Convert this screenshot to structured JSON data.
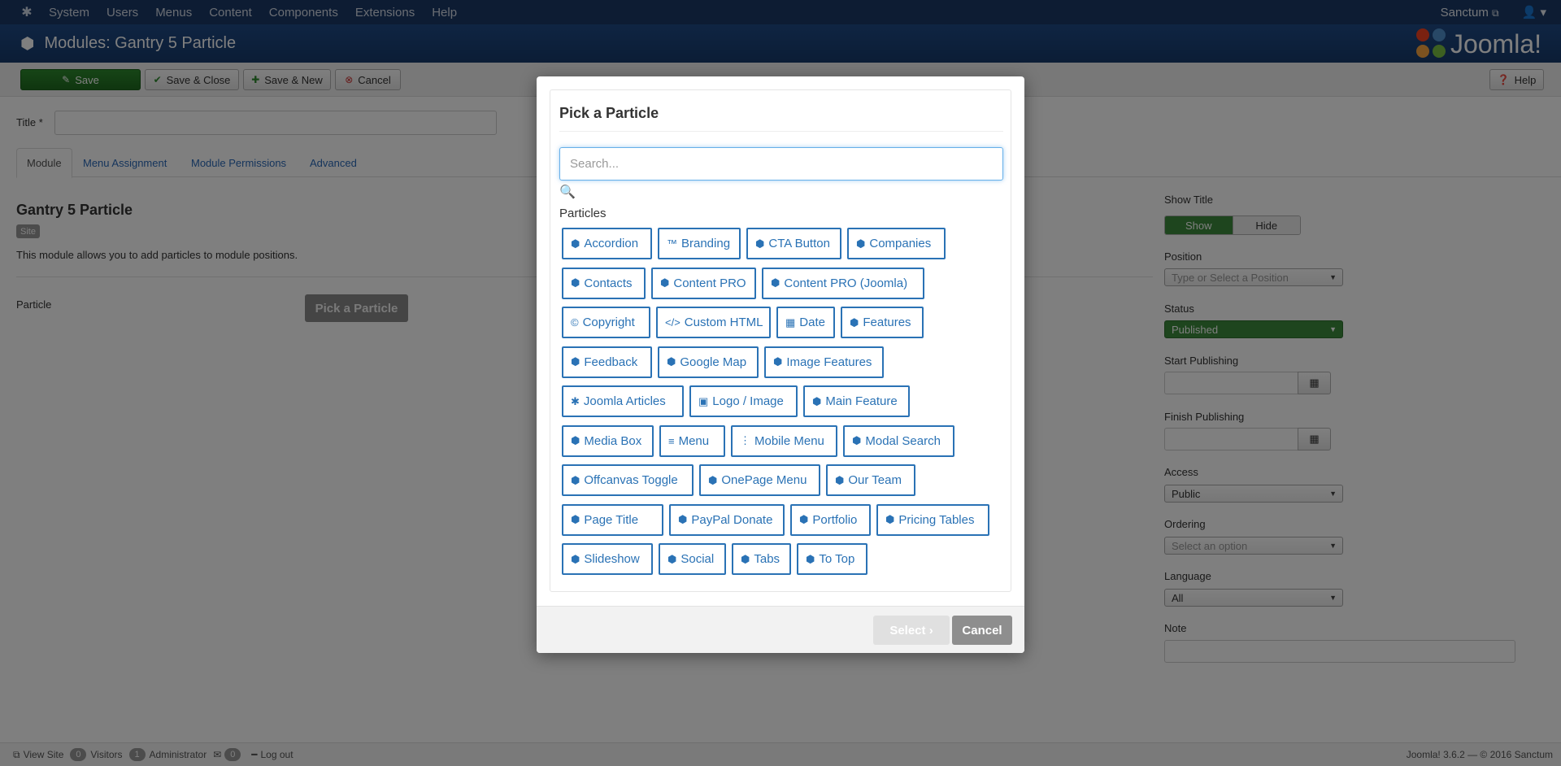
{
  "topnav": {
    "menu": [
      "System",
      "Users",
      "Menus",
      "Content",
      "Components",
      "Extensions",
      "Help"
    ],
    "site_name": "Sanctum"
  },
  "header": {
    "title": "Modules: Gantry 5 Particle",
    "brand": "Joomla!"
  },
  "toolbar": {
    "save": "Save",
    "save_close": "Save & Close",
    "save_new": "Save & New",
    "cancel": "Cancel",
    "help": "Help"
  },
  "form": {
    "title_label": "Title *",
    "tabs": [
      "Module",
      "Menu Assignment",
      "Module Permissions",
      "Advanced"
    ],
    "module_name": "Gantry 5 Particle",
    "site_badge": "Site",
    "description": "This module allows you to add particles to module positions.",
    "particle_label": "Particle",
    "pick_button": "Pick a Particle"
  },
  "sidebar": {
    "show_title_label": "Show Title",
    "show": "Show",
    "hide": "Hide",
    "position_label": "Position",
    "position_placeholder": "Type or Select a Position",
    "status_label": "Status",
    "status_value": "Published",
    "start_label": "Start Publishing",
    "finish_label": "Finish Publishing",
    "access_label": "Access",
    "access_value": "Public",
    "ordering_label": "Ordering",
    "ordering_placeholder": "Select an option",
    "language_label": "Language",
    "language_value": "All",
    "note_label": "Note"
  },
  "statusbar": {
    "view_site": "View Site",
    "visitors_count": "0",
    "visitors": "Visitors",
    "admin_count": "1",
    "administrator": "Administrator",
    "messages_count": "0",
    "logout": "Log out",
    "version": "Joomla! 3.6.2 — © 2016 Sanctum"
  },
  "modal": {
    "title": "Pick a Particle",
    "search_placeholder": "Search...",
    "section": "Particles",
    "select": "Select",
    "cancel": "Cancel",
    "particles": [
      {
        "label": "Accordion",
        "icon": "cube-icon"
      },
      {
        "label": "Branding",
        "icon": "trademark-icon"
      },
      {
        "label": "CTA Button",
        "icon": "cube-icon"
      },
      {
        "label": "Companies",
        "icon": "cube-icon"
      },
      {
        "label": "Contacts",
        "icon": "cube-icon"
      },
      {
        "label": "Content PRO",
        "icon": "cube-icon"
      },
      {
        "label": "Content PRO (Joomla)",
        "icon": "cube-icon"
      },
      {
        "label": "Copyright",
        "icon": "copyright-icon"
      },
      {
        "label": "Custom HTML",
        "icon": "code-icon"
      },
      {
        "label": "Date",
        "icon": "calendar-icon"
      },
      {
        "label": "Features",
        "icon": "cube-icon"
      },
      {
        "label": "Feedback",
        "icon": "cube-icon"
      },
      {
        "label": "Google Map",
        "icon": "cube-icon"
      },
      {
        "label": "Image Features",
        "icon": "cube-icon"
      },
      {
        "label": "Joomla Articles",
        "icon": "joomla-icon"
      },
      {
        "label": "Logo / Image",
        "icon": "image-icon"
      },
      {
        "label": "Main Feature",
        "icon": "cube-icon"
      },
      {
        "label": "Media Box",
        "icon": "cube-icon"
      },
      {
        "label": "Menu",
        "icon": "bars-icon"
      },
      {
        "label": "Mobile Menu",
        "icon": "ellipsis-vertical-icon"
      },
      {
        "label": "Modal Search",
        "icon": "cube-icon"
      },
      {
        "label": "Offcanvas Toggle",
        "icon": "cube-icon"
      },
      {
        "label": "OnePage Menu",
        "icon": "cube-icon"
      },
      {
        "label": "Our Team",
        "icon": "cube-icon"
      },
      {
        "label": "Page Title",
        "icon": "cube-icon"
      },
      {
        "label": "PayPal Donate",
        "icon": "cube-icon"
      },
      {
        "label": "Portfolio",
        "icon": "cube-icon"
      },
      {
        "label": "Pricing Tables",
        "icon": "cube-icon"
      },
      {
        "label": "Slideshow",
        "icon": "cube-icon"
      },
      {
        "label": "Social",
        "icon": "cube-icon"
      },
      {
        "label": "Tabs",
        "icon": "cube-icon"
      },
      {
        "label": "To Top",
        "icon": "cube-icon"
      }
    ]
  }
}
